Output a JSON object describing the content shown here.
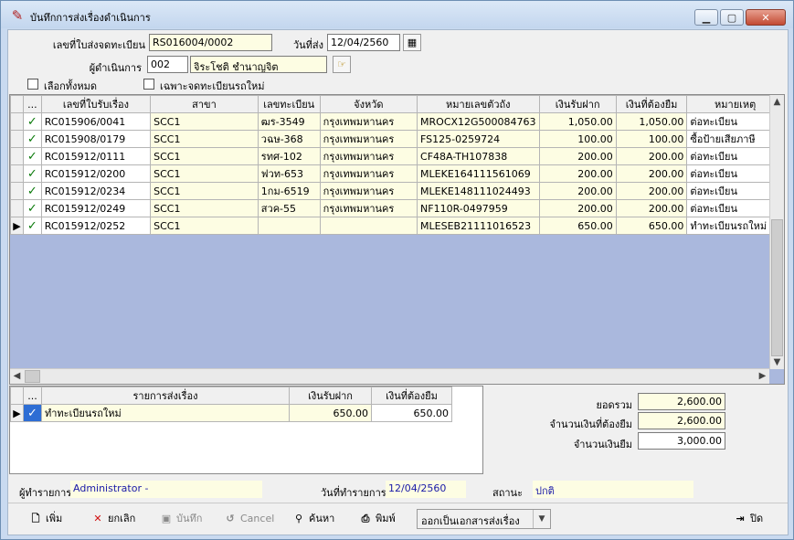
{
  "window": {
    "title": "บันทึกการส่งเรื่องดำเนินการ",
    "minimize_label": "▁",
    "maximize_label": "▢",
    "close_label": "✕"
  },
  "form": {
    "receipt_no_label": "เลขที่ใบส่งจดทะเบียน",
    "receipt_no_value": "RS016004/0002",
    "send_date_label": "วันที่ส่ง",
    "send_date_value": "12/04/2560",
    "operator_label": "ผู้ดำเนินการ",
    "operator_code": "002",
    "operator_name": "จิระโชติ ชำนาญจิต",
    "select_all_label": "เลือกทั้งหมด",
    "new_reg_only_label": "เฉพาะจดทะเบียนรถใหม่"
  },
  "grid": {
    "columns": [
      "...",
      "เลขที่ใบรับเรื่อง",
      "สาขา",
      "เลขทะเบียน",
      "จังหวัด",
      "หมายเลขตัวถัง",
      "เงินรับฝาก",
      "เงินที่ต้องยืม",
      "หมายเหตุ"
    ],
    "rows": [
      {
        "checked": "✓",
        "receipt": "RC015906/0041",
        "branch": "SCC1",
        "plate": "ฒร-3549",
        "province": "กรุงเทพมหานคร",
        "chassis": "MROCX12G500084763",
        "deposit": "1,050.00",
        "borrow": "1,050.00",
        "note": "ต่อทะเบียน"
      },
      {
        "checked": "✓",
        "receipt": "RC015908/0179",
        "branch": "SCC1",
        "plate": "วฉษ-368",
        "province": "กรุงเทพมหานคร",
        "chassis": "FS125-0259724",
        "deposit": "100.00",
        "borrow": "100.00",
        "note": "ซื้อป้ายเสียภาษี"
      },
      {
        "checked": "✓",
        "receipt": "RC015912/0111",
        "branch": "SCC1",
        "plate": "รทศ-102",
        "province": "กรุงเทพมหานคร",
        "chassis": "CF48A-TH107838",
        "deposit": "200.00",
        "borrow": "200.00",
        "note": "ต่อทะเบียน"
      },
      {
        "checked": "✓",
        "receipt": "RC015912/0200",
        "branch": "SCC1",
        "plate": "ฟวท-653",
        "province": "กรุงเทพมหานคร",
        "chassis": "MLEKE164111561069",
        "deposit": "200.00",
        "borrow": "200.00",
        "note": "ต่อทะเบียน"
      },
      {
        "checked": "✓",
        "receipt": "RC015912/0234",
        "branch": "SCC1",
        "plate": "1กม-6519",
        "province": "กรุงเทพมหานคร",
        "chassis": "MLEKE148111024493",
        "deposit": "200.00",
        "borrow": "200.00",
        "note": "ต่อทะเบียน"
      },
      {
        "checked": "✓",
        "receipt": "RC015912/0249",
        "branch": "SCC1",
        "plate": "สวค-55",
        "province": "กรุงเทพมหานคร",
        "chassis": "NF110R-0497959",
        "deposit": "200.00",
        "borrow": "200.00",
        "note": "ต่อทะเบียน"
      },
      {
        "checked": "✓",
        "receipt": "RC015912/0252",
        "branch": "SCC1",
        "plate": "",
        "province": "",
        "chassis": "MLESEB21111016523",
        "deposit": "650.00",
        "borrow": "650.00",
        "note": "ทำทะเบียนรถใหม่"
      }
    ]
  },
  "subgrid": {
    "columns": [
      "...",
      "รายการส่งเรื่อง",
      "เงินรับฝาก",
      "เงินที่ต้องยืม"
    ],
    "rows": [
      {
        "checked": "✓",
        "item": "ทำทะเบียนรถใหม่",
        "deposit": "650.00",
        "borrow": "650.00"
      }
    ]
  },
  "totals": {
    "total_label": "ยอดรวม",
    "total_value": "2,600.00",
    "borrow_label": "จำนวนเงินที่ต้องยืม",
    "borrow_value": "2,600.00",
    "amount_label": "จำนวนเงินยืม",
    "amount_value": "3,000.00"
  },
  "status": {
    "recorder_label": "ผู้ทำรายการ",
    "recorder_value": "Administrator -",
    "date_label": "วันที่ทำรายการ",
    "date_value": "12/04/2560",
    "state_label": "สถานะ",
    "state_value": "ปกติ"
  },
  "toolbar": {
    "add": "เพิ่ม",
    "cancel_doc": "ยกเลิก",
    "save": "บันทึก",
    "cancel": "Cancel",
    "search": "ค้นหา",
    "print": "พิมพ์",
    "print_option": "ออกเป็นเอกสารส่งเรื่อง",
    "close": "ปิด"
  },
  "colors": {
    "input_yellow": "#fdfde3",
    "grid_empty": "#aab8dd",
    "check_green": "#0a7a0a",
    "value_blue": "#1a1aa8"
  }
}
